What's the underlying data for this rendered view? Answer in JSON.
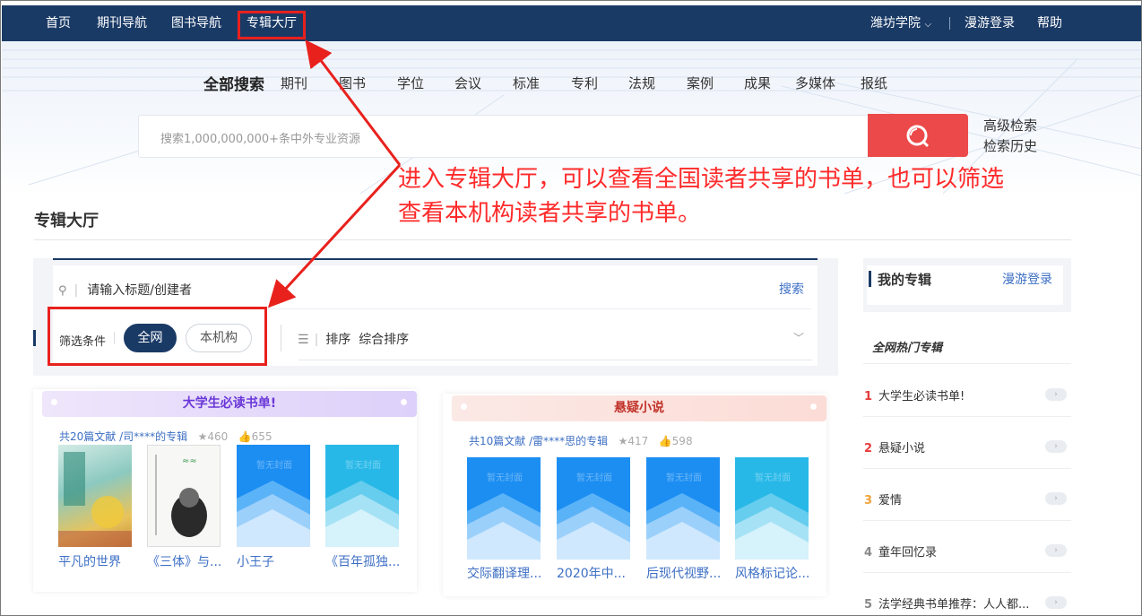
{
  "nav": {
    "items": [
      "首页",
      "期刊导航",
      "图书导航",
      "专辑大厅"
    ],
    "institution": "潍坊学院",
    "login": "漫游登录",
    "help": "帮助"
  },
  "search": {
    "types": [
      "全部搜索",
      "期刊",
      "图书",
      "学位",
      "会议",
      "标准",
      "专利",
      "法规",
      "案例",
      "成果",
      "多媒体",
      "报纸"
    ],
    "placeholder": "搜索1,000,000,000+条中外专业资源",
    "advanced": "高级检索",
    "history": "检索历史"
  },
  "annotation": {
    "line1": "进入专辑大厅，可以查看全国读者共享的书单，也可以筛选",
    "line2": "查看本机构读者共享的书单。",
    "color": "#ff2a2a"
  },
  "page": {
    "title": "专辑大厅"
  },
  "filter": {
    "search_placeholder": "请输入标题/创建者",
    "search_button": "搜索",
    "label": "筛选条件",
    "options": [
      "全网",
      "本机构"
    ],
    "sort_label": "排序",
    "sort_value": "综合排序"
  },
  "albums": [
    {
      "title": "大学生必读书单!",
      "meta": "共20篇文献 /司****的专辑",
      "stars": "460",
      "likes": "655",
      "books": [
        "平凡的世界",
        "《三体》与...",
        "小王子",
        "《百年孤独..."
      ]
    },
    {
      "title": "悬疑小说",
      "meta": "共10篇文献 /雷****思的专辑",
      "stars": "417",
      "likes": "598",
      "books": [
        "交际翻译理...",
        "2020年中...",
        "后现代视野...",
        "风格标记论..."
      ]
    }
  ],
  "sidebar": {
    "my_albums": "我的专辑",
    "login": "漫游登录",
    "hot_title": "全网热门专辑",
    "hot": [
      {
        "rank": "1",
        "title": "大学生必读书单!"
      },
      {
        "rank": "2",
        "title": "悬疑小说"
      },
      {
        "rank": "3",
        "title": "爱情"
      },
      {
        "rank": "4",
        "title": "童年回忆录"
      },
      {
        "rank": "5",
        "title": "法学经典书单推荐：人人都..."
      }
    ]
  },
  "colors": {
    "nav_bg": "#1a3a66",
    "accent_red": "#ec4a4a",
    "link_blue": "#3d6fc4",
    "rank_red": "#e63c3c",
    "rank_orange": "#f0a23c"
  },
  "cover_watermark": "暂无封面"
}
